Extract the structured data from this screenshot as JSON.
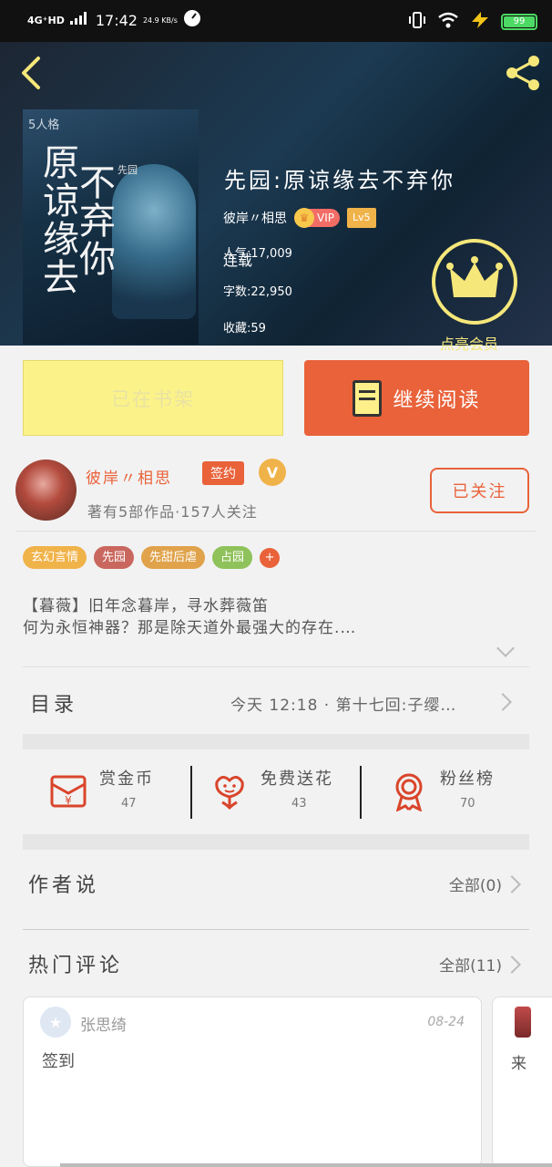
{
  "status_bar": {
    "network": "4G⁺HD",
    "time": "17:42",
    "speed": "24.9 KB/s",
    "battery": "99",
    "battery_level": 0.99
  },
  "book": {
    "title": "先园:原谅缘去不弃你",
    "author": "彼岸〃相思",
    "vip_label": "VIP",
    "level_label": "Lv5",
    "status": "连载",
    "popularity": "人气:17,009",
    "word_count": "字数:22,950",
    "favorites": "收藏:59",
    "cover": {
      "brand": "5人格",
      "title_line1": "原谅缘去",
      "title_line2": "不弃你",
      "subtitle": "先园"
    }
  },
  "member": {
    "label": "点亮会员"
  },
  "buttons": {
    "shelf": "已在书架",
    "read": "继续阅读",
    "follow": "已关注"
  },
  "author_card": {
    "name": "彼岸〃相思",
    "signed": "签约",
    "v_badge": "V",
    "meta": "著有5部作品·157人关注"
  },
  "tags": [
    {
      "label": "玄幻言情",
      "color": "#f0b34a"
    },
    {
      "label": "先园",
      "color": "#c9675e"
    },
    {
      "label": "先甜后虐",
      "color": "#e0a24a"
    },
    {
      "label": "占园",
      "color": "#8fc25a"
    },
    {
      "label": "+",
      "color": "#e9623a"
    }
  ],
  "synopsis": {
    "line1": "【暮薇】旧年念暮岸，寻水葬薇笛",
    "line2": "何为永恒神器？那是除天道外最强大的存在.…"
  },
  "toc": {
    "title": "目录",
    "latest": "今天 12:18 · 第十七回:子缨…"
  },
  "actions": [
    {
      "label": "赏金币",
      "count": "47",
      "icon": "red-envelope-icon"
    },
    {
      "label": "免费送花",
      "count": "43",
      "icon": "flower-icon"
    },
    {
      "label": "粉丝榜",
      "count": "70",
      "icon": "medal-icon"
    }
  ],
  "author_says": {
    "title": "作者说",
    "more": "全部(0)"
  },
  "hot_comments": {
    "title": "热门评论",
    "more": "全部(11)"
  },
  "comments": [
    {
      "user": "张思绮",
      "date": "08-24",
      "body": "签到"
    },
    {
      "user": "",
      "date": "",
      "body": "来"
    }
  ],
  "colors": {
    "accent": "#e9623a",
    "shelf_yellow": "#fbf389",
    "member_gold": "#f5e77a",
    "hero_bg": "#1c3a52"
  }
}
